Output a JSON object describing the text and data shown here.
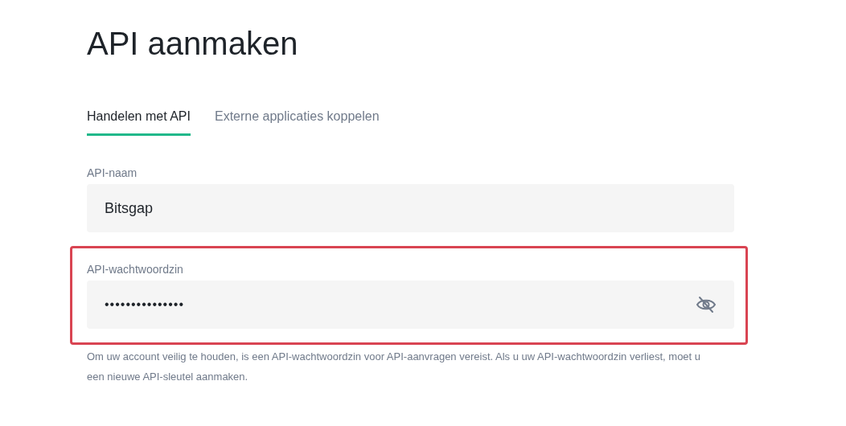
{
  "title": "API aanmaken",
  "tabs": [
    {
      "label": "Handelen met API",
      "selected": true
    },
    {
      "label": "Externe applicaties koppelen",
      "selected": false
    }
  ],
  "fields": [
    {
      "label": "API-naam",
      "value": "Bitsgap",
      "kind": "text",
      "highlighted": false
    },
    {
      "label": "API-wachtwoordzin",
      "value": "•••••••••••••••",
      "kind": "password",
      "highlighted": true
    }
  ],
  "help_text": "Om uw account veilig te houden, is een API-wachtwoordzin voor API-aanvragen vereist. Als u uw API-wachtwoordzin verliest, moet u een nieuwe API-sleutel aanmaken."
}
